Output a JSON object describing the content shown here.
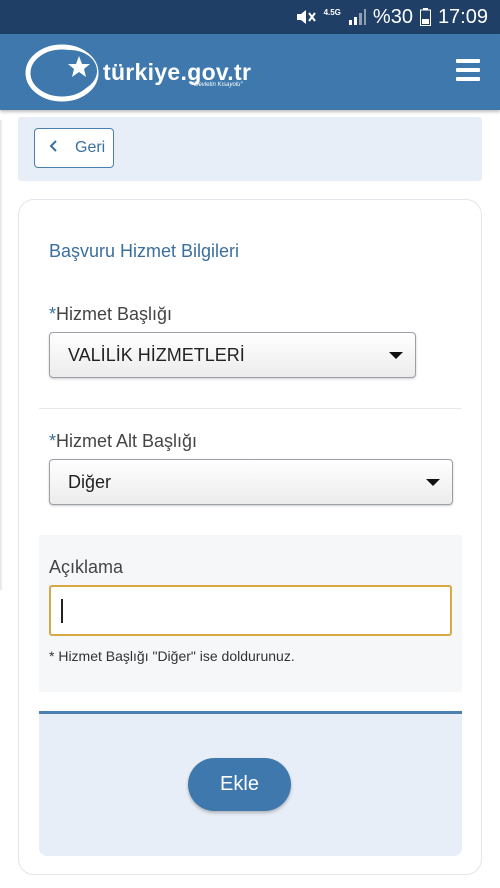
{
  "status_bar": {
    "network": "4.5G",
    "battery_percent": "%30",
    "time": "17:09"
  },
  "header": {
    "logo_title": "türkiye.gov.tr",
    "logo_slogan": "\"Devletin Kısayolu\""
  },
  "back_button": {
    "label": "Geri"
  },
  "form": {
    "section_title": "Başvuru Hizmet Bilgileri",
    "service_title": {
      "required_mark": "*",
      "label": "Hizmet Başlığı",
      "selected": "VALİLİK HİZMETLERİ"
    },
    "service_subtitle": {
      "required_mark": "*",
      "label": "Hizmet Alt Başlığı",
      "selected": "Diğer"
    },
    "description": {
      "label": "Açıklama",
      "value": "",
      "hint": "* Hizmet Başlığı \"Diğer\" ise doldurunuz."
    },
    "submit_label": "Ekle"
  },
  "colors": {
    "status_bar": "#1f3f66",
    "header": "#3e78ac",
    "accent_text": "#3b6f9e",
    "panel_background": "#e8eef7",
    "focus_border": "#d8a843"
  },
  "icons": {
    "mute": "mute-icon",
    "signal": "signal-icon",
    "battery": "battery-icon",
    "menu": "hamburger-menu-icon",
    "back": "chevron-left-icon"
  }
}
